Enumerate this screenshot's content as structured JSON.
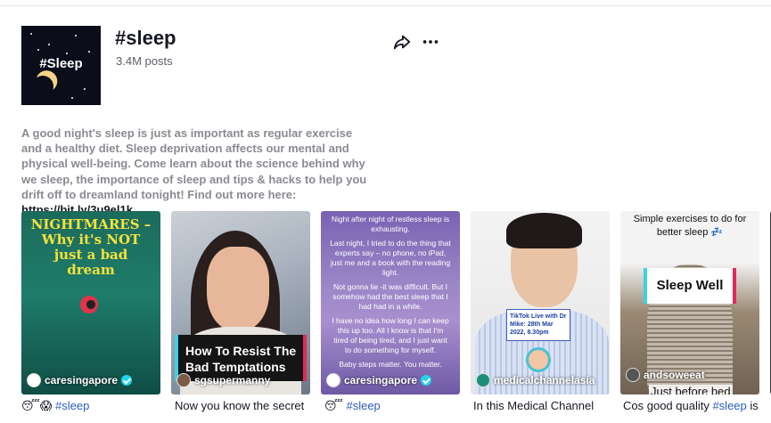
{
  "header": {
    "cover_text": "#Sleep",
    "title": "#sleep",
    "posts": "3.4M posts",
    "share_icon": "share-arrow-icon",
    "more_icon": "more-horizontal-icon"
  },
  "description": {
    "text": "A good night's sleep is just as important as regular exercise and a healthy diet. Sleep deprivation affects our mental and physical well-being. Come learn about the science behind why we sleep, the importance of sleep and tips & hacks to help you drift off to dreamland tonight! Find out more here: ",
    "link": "https://bit.ly/3u9el1k"
  },
  "videos": [
    {
      "overlay_title": "NIGHTMARES – Why it's NOT just a bad dream",
      "handle": "caresingapore",
      "verified": true,
      "caption_prefix": "😴😱 ",
      "caption_tag": "#sleep",
      "caption_text": ""
    },
    {
      "overlay_title": "How To Resist The Bad Temptations",
      "handle": "sgsupermanny",
      "verified": false,
      "caption_prefix": "",
      "caption_tag": "",
      "caption_text": "Now you know the secret"
    },
    {
      "overlay_lines": [
        "Night after night of restless sleep is exhausting.",
        "Last night, I tried to do the thing that experts say – no phone, no iPad, just me and a book with the reading light.",
        "Not gonna lie -it was difficult. But I somehow had the best sleep that I had had in a while.",
        "I have no idea how long I can keep this up too. All I know is that I'm tired of being tired, and I just want to do something for myself.",
        "Baby steps matter. You matter."
      ],
      "handle": "caresingapore",
      "verified": true,
      "caption_prefix": "😴 ",
      "caption_tag": "#sleep",
      "caption_text": ""
    },
    {
      "overlay_badge": "TikTok Live with Dr Mike: 28th Mar 2022, 8.30pm",
      "handle": "medicalchannelasia",
      "verified": false,
      "caption_prefix": "",
      "caption_tag": "",
      "caption_text": "In this Medical Channel"
    },
    {
      "overlay_top": "Simple exercises to do for better sleep 💤",
      "overlay_title": "Sleep Well",
      "overlay_bottom": "Just before bed",
      "handle": "andsoweeat",
      "verified": false,
      "caption_prefix": "Cos good quality ",
      "caption_tag": "#sleep",
      "caption_text": " is"
    }
  ]
}
